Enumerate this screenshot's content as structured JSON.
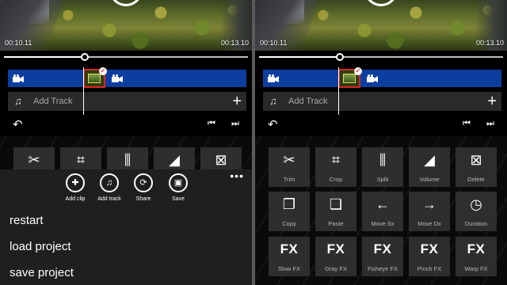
{
  "player": {
    "current_time": "00:10.11",
    "total_time": "00:13.10",
    "progress_percent": 33
  },
  "timeline": {
    "add_track_label": "Add Track"
  },
  "tools": [
    {
      "icon": "scissors-icon",
      "glyph": "✂",
      "label": "Trim"
    },
    {
      "icon": "crop-icon",
      "glyph": "⌗",
      "label": "Crop"
    },
    {
      "icon": "split-icon",
      "glyph": "⫼",
      "label": "Split"
    },
    {
      "icon": "volume-icon",
      "glyph": "◢",
      "label": "Volume"
    },
    {
      "icon": "delete-icon",
      "glyph": "⊠",
      "label": "Delete"
    },
    {
      "icon": "copy-icon",
      "glyph": "❐",
      "label": "Copy"
    },
    {
      "icon": "paste-icon",
      "glyph": "❏",
      "label": "Paste"
    },
    {
      "icon": "arrow-left-icon",
      "glyph": "←",
      "label": "Move Sx"
    },
    {
      "icon": "arrow-right-icon",
      "glyph": "→",
      "label": "Move Dx"
    },
    {
      "icon": "clock-icon",
      "glyph": "◷",
      "label": "Duration"
    },
    {
      "icon": "fx-icon",
      "glyph": "FX",
      "label": "Slow FX"
    },
    {
      "icon": "fx-icon",
      "glyph": "FX",
      "label": "Gray FX"
    },
    {
      "icon": "fx-icon",
      "glyph": "FX",
      "label": "Fisheye FX"
    },
    {
      "icon": "fx-icon",
      "glyph": "FX",
      "label": "Pinch FX"
    },
    {
      "icon": "fx-icon",
      "glyph": "FX",
      "label": "Warp FX"
    }
  ],
  "appbar": {
    "actions": [
      {
        "icon": "add-clip-icon",
        "glyph": "✚",
        "label": "Add clip"
      },
      {
        "icon": "add-track-icon",
        "glyph": "♫",
        "label": "Add track"
      },
      {
        "icon": "share-icon",
        "glyph": "⟳",
        "label": "Share"
      },
      {
        "icon": "save-icon",
        "glyph": "▣",
        "label": "Save"
      }
    ],
    "more_glyph": "•••",
    "menu": [
      "restart",
      "load project",
      "save project"
    ]
  },
  "colors": {
    "video_track": "#0c3ea0",
    "selected_clip_border": "#e02222",
    "tool_button": "#2e2e2e",
    "appbar": "#1f1f1f"
  }
}
